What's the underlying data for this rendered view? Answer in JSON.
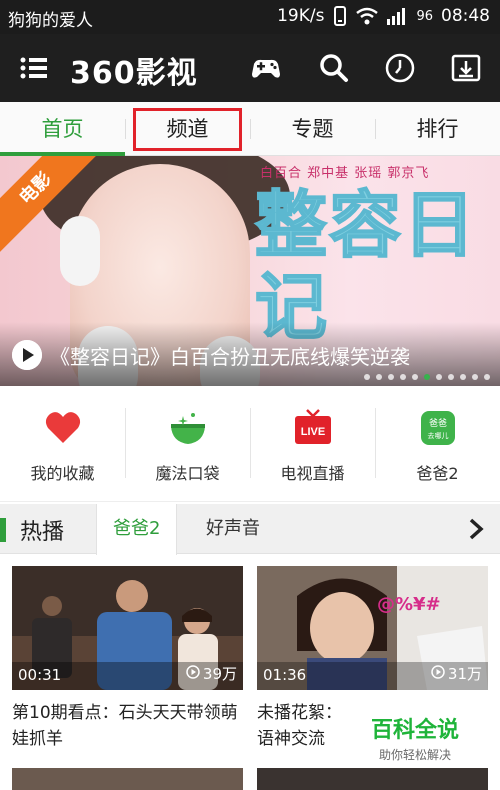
{
  "status": {
    "carrier": "狗狗的爱人",
    "speed": "19K/s",
    "battery": "96",
    "time": "08:48"
  },
  "appbar": {
    "logo": "360影视",
    "icons": [
      "menu-icon",
      "gamepad-icon",
      "search-icon",
      "history-clock-icon",
      "download-icon"
    ]
  },
  "tabs": [
    {
      "label": "首页",
      "active": true
    },
    {
      "label": "频道",
      "highlighted": true
    },
    {
      "label": "专题"
    },
    {
      "label": "排行"
    }
  ],
  "banner": {
    "corner_tag": "电影",
    "cast": "白百合 郑中基 张瑶 郭京飞",
    "title_art": "整容日记",
    "caption": "《整容日记》白百合扮丑无底线爆笑逆袭",
    "dot_count": 11,
    "active_dot": 5
  },
  "quick": [
    {
      "label": "我的收藏",
      "icon": "heart-icon"
    },
    {
      "label": "魔法口袋",
      "icon": "magic-bowl-icon"
    },
    {
      "label": "电视直播",
      "icon": "live-tv-icon"
    },
    {
      "label": "爸爸2",
      "icon": "show-logo-icon",
      "icon_text": "爸爸去哪儿"
    }
  ],
  "hot": {
    "title": "热播",
    "subtabs": [
      {
        "label": "爸爸2",
        "active": true
      },
      {
        "label": "好声音"
      }
    ]
  },
  "videos": [
    {
      "duration": "00:31",
      "plays": "39万",
      "desc": "第10期看点：石头天天带领萌娃抓羊"
    },
    {
      "duration": "01:36",
      "plays": "31万",
      "desc": "未播花絮：",
      "overlay": "@%¥#",
      "desc2": "语神交流"
    }
  ],
  "watermark": {
    "main": "百科全说",
    "sub": "助你轻松解决"
  },
  "colors": {
    "accent_green": "#2f9e3c",
    "highlight_red": "#e1222a",
    "corner_orange": "#f0761e"
  }
}
